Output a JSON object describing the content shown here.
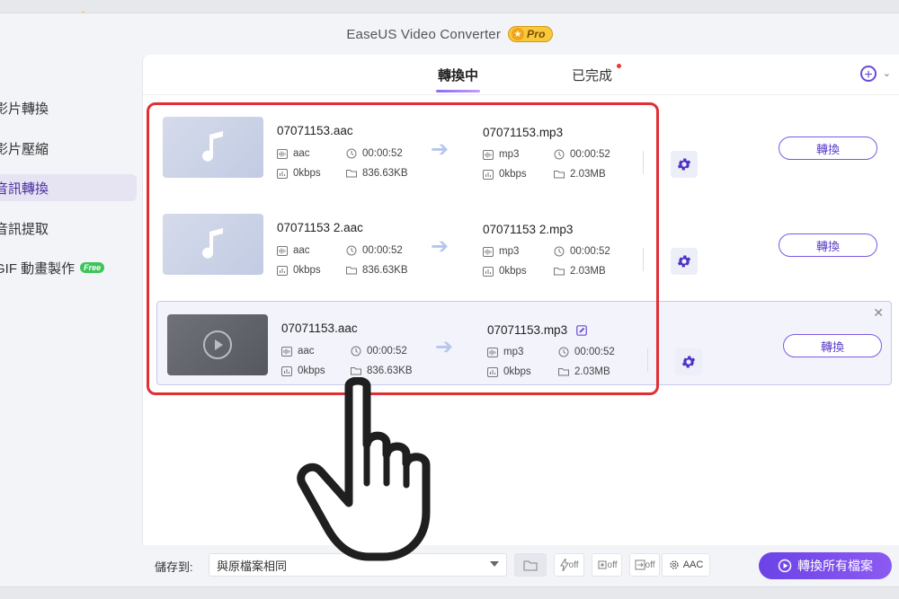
{
  "window": {
    "title": "EaseUS Video Converter",
    "pro_label": "Pro"
  },
  "sidebar": {
    "items": [
      {
        "label": "影片轉換"
      },
      {
        "label": "影片壓縮"
      },
      {
        "label": "音訊轉換",
        "active": true
      },
      {
        "label": "音訊提取"
      },
      {
        "label": "GIF 動畫製作",
        "badge": "Free"
      }
    ]
  },
  "tabs": [
    {
      "label": "轉換中",
      "active": true
    },
    {
      "label": "已完成",
      "has_dot": true
    }
  ],
  "rows": [
    {
      "thumb_type": "audio",
      "src": {
        "name": "07071153.aac",
        "format": "aac",
        "duration": "00:00:52",
        "bitrate": "0kbps",
        "size": "836.63KB"
      },
      "dst": {
        "name": "07071153.mp3",
        "format": "mp3",
        "duration": "00:00:52",
        "bitrate": "0kbps",
        "size": "2.03MB"
      },
      "convert_label": "轉換"
    },
    {
      "thumb_type": "audio",
      "src": {
        "name": "07071153 2.aac",
        "format": "aac",
        "duration": "00:00:52",
        "bitrate": "0kbps",
        "size": "836.63KB"
      },
      "dst": {
        "name": "07071153 2.mp3",
        "format": "mp3",
        "duration": "00:00:52",
        "bitrate": "0kbps",
        "size": "2.03MB"
      },
      "convert_label": "轉換"
    },
    {
      "thumb_type": "video",
      "src": {
        "name": "07071153.aac",
        "format": "aac",
        "duration": "00:00:52",
        "bitrate": "0kbps",
        "size": "836.63KB"
      },
      "dst": {
        "name": "07071153.mp3",
        "format": "mp3",
        "duration": "00:00:52",
        "bitrate": "0kbps",
        "size": "2.03MB"
      },
      "convert_label": "轉換"
    }
  ],
  "bottom": {
    "save_to_label": "儲存到:",
    "save_location": "與原檔案相同",
    "tools": [
      "off",
      "off",
      "off"
    ],
    "audio_codec": "AAC",
    "convert_all_label": "轉換所有檔案"
  },
  "colors": {
    "accent": "#6b43e6",
    "highlight": "#e02f35",
    "sparkle": "#f8c61b"
  }
}
